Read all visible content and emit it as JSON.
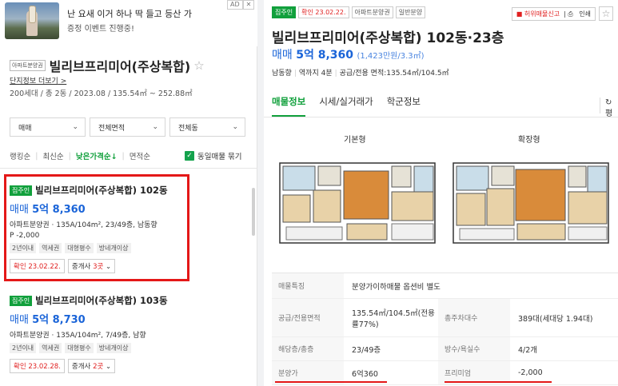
{
  "ad": {
    "line1": "난 요새 이거 하나 딱 들고 등산 가",
    "line2": "증정 이벤트 진행중!",
    "badge": "AD",
    "close": "✕"
  },
  "complex": {
    "type_tag": "아파트분양권",
    "name": "빌리브프리미어(주상복합)",
    "star": "☆",
    "link": "단지정보 더보기",
    "info": "200세대 / 총 2동 / 2023.08 / 135.54㎡ ~ 252.88㎡"
  },
  "filters": [
    {
      "label": "매매",
      "chev": "⌄"
    },
    {
      "label": "전체면적",
      "chev": "⌄"
    },
    {
      "label": "전체동",
      "chev": "⌄"
    }
  ],
  "sorts": [
    "랭킹순",
    "최신순",
    "낮은가격순↓",
    "면적순"
  ],
  "group_check": {
    "label": "동일매물 묶기",
    "mark": "✓"
  },
  "listings": [
    {
      "tag": "집주인",
      "name": "빌리브프리미어(주상복합) 102동",
      "price_type": "매매",
      "price": "5억 8,360",
      "spec": "아파트분양권 · 135A/104m², 23/49층, 남동향",
      "premium": "P -2,000",
      "chips": [
        "2년이내",
        "역세권",
        "대형평수",
        "방네개이상"
      ],
      "date": "확인 23.02.22.",
      "agents_prefix": "중개사 ",
      "agents_count": "3곳",
      "agents_chev": "⌄"
    },
    {
      "tag": "집주인",
      "name": "빌리브프리미어(주상복합) 103동",
      "price_type": "매매",
      "price": "5억 8,730",
      "spec": "아파트분양권 · 135A/104m², 7/49층, 남향",
      "chips": [
        "2년이내",
        "역세권",
        "대형평수",
        "방네개이상"
      ],
      "date": "확인 23.02.28.",
      "agents_prefix": "중개사 ",
      "agents_count": "2곳",
      "agents_chev": "⌄"
    }
  ],
  "detail": {
    "tags": [
      "집주인",
      "확인 23.02.22.",
      "아파트분양권",
      "일반분양"
    ],
    "report": "허위매물신고",
    "print": "인쇄",
    "fav": "☆",
    "title": "빌리브프리미어(주상복합) 102동·23층",
    "price_type": "매매",
    "price": "5억 8,360",
    "price_per": "(1,423만원/3.3㎡)",
    "info": [
      "남동향",
      "역까지 4분",
      "공급/전용 면적:135.54㎡/104.5㎡"
    ],
    "tabs": [
      "매물정보",
      "시세/실거래가",
      "학군정보"
    ],
    "refresh": "↻ 평",
    "floorplans": [
      "기본형",
      "확장형"
    ],
    "table": {
      "feature_label": "매물특징",
      "feature_value": "분양가이하매물 옵션비 별도",
      "rows": [
        {
          "k1": "공급/전용면적",
          "v1": "135.54㎡/104.5㎡(전용률77%)",
          "k2": "총주차대수",
          "v2": "389대(세대당 1.94대)"
        },
        {
          "k1": "해당층/총층",
          "v1": "23/49층",
          "k2": "방수/욕실수",
          "v2": "4/2개"
        },
        {
          "k1": "분양가",
          "v1": "6억360",
          "k2": "프리미엄",
          "v2": "-2,000"
        }
      ]
    }
  },
  "colors": {
    "accent_green": "#11a03c",
    "price_blue": "#1a64d8",
    "highlight_red": "#e41818"
  }
}
